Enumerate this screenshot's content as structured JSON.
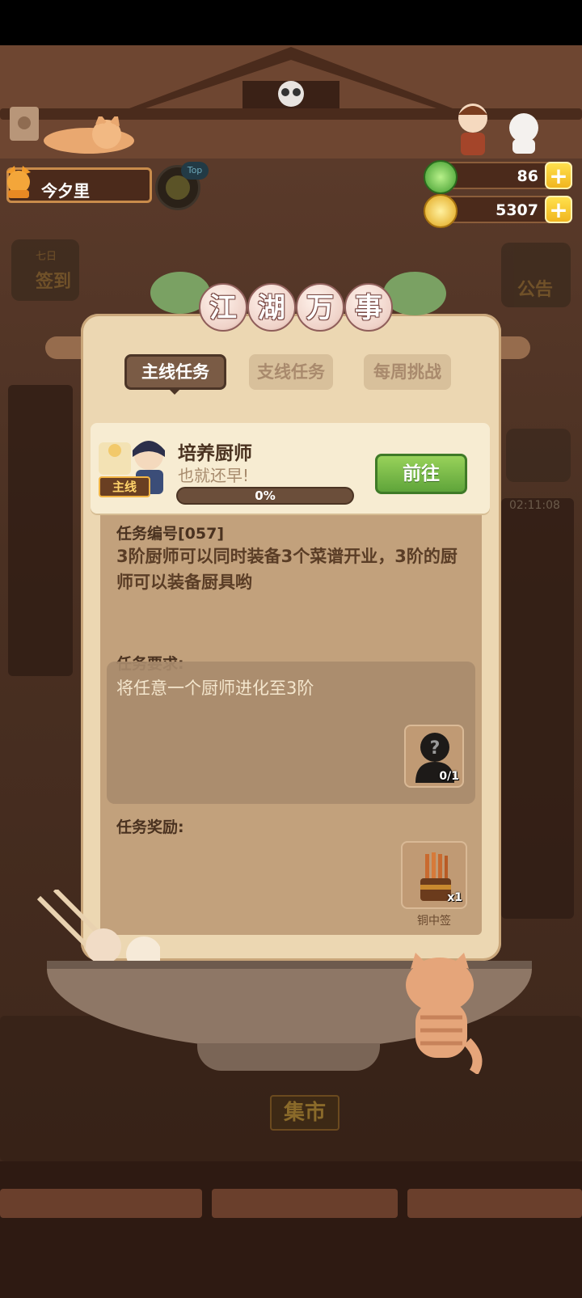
{
  "header": {
    "player_name": "今夕里",
    "top_badge": "Top",
    "jade_amount": "86",
    "coin_amount": "5307",
    "plus_label": "+"
  },
  "side_buttons": {
    "left_sign_in": "签到",
    "left_sign_in_small": "七日",
    "right_notice": "公告",
    "right_timer": "02:11:08"
  },
  "panel": {
    "title_chars": [
      "江",
      "湖",
      "万",
      "事"
    ],
    "tabs": [
      {
        "label": "主线任务",
        "active": true
      },
      {
        "label": "支线任务",
        "active": false
      },
      {
        "label": "每周挑战",
        "active": false
      }
    ],
    "quest": {
      "tag": "主线",
      "title": "培养厨师",
      "subtitle": "也就还早!",
      "progress_percent": 0,
      "progress_label": "0%",
      "go_button": "前往"
    },
    "task_number_label": "任务编号[057]",
    "description": "3阶厨师可以同时装备3个菜谱开业，3阶的厨师可以装备厨具哟",
    "requirement_label": "任务要求:",
    "requirement_text": "将任意一个厨师进化至3阶",
    "requirement_slot": {
      "icon": "mystery-chef-icon",
      "count": "0/1"
    },
    "reward_label": "任务奖励:",
    "reward_item": {
      "icon": "copper-chopsticks-icon",
      "count": "x1",
      "name": "铜中签"
    }
  },
  "bottom": {
    "market_label": "集市"
  },
  "colors": {
    "panel_bg": "#ecd7b2",
    "go_button": "#6fb443",
    "tab_active": "#7a5b45",
    "currency_plus": "#f0b51f"
  }
}
